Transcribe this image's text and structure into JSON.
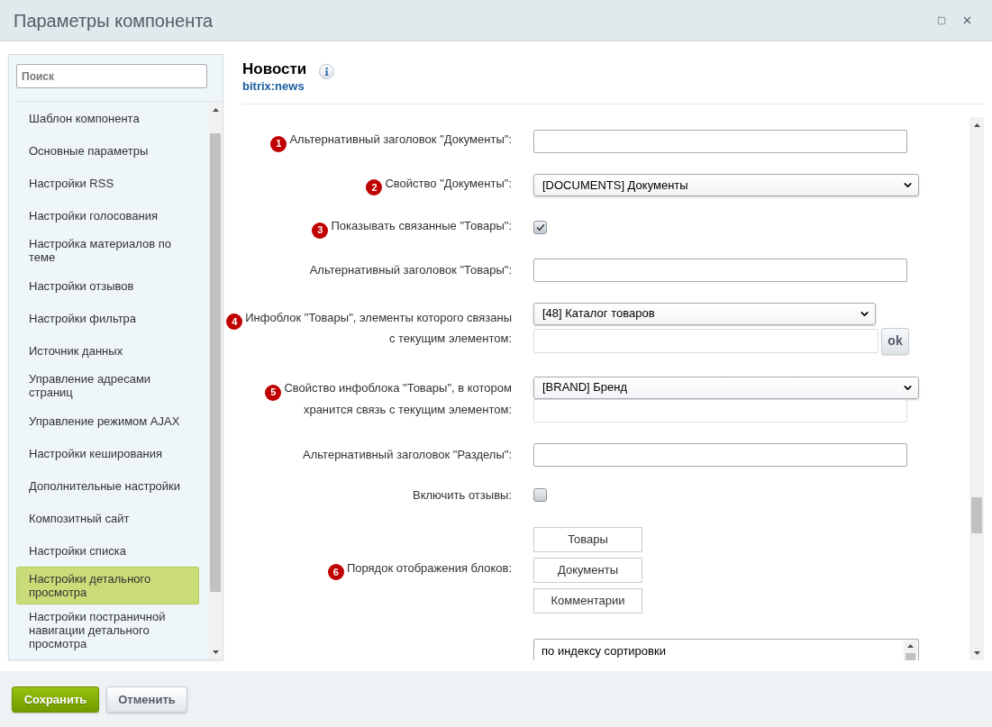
{
  "window": {
    "title": "Параметры компонента"
  },
  "sidebar": {
    "search": {
      "placeholder": "Поиск"
    },
    "items": [
      {
        "label": "Шаблон компонента",
        "selected": false
      },
      {
        "label": "Основные параметры",
        "selected": false
      },
      {
        "label": "Настройки RSS",
        "selected": false
      },
      {
        "label": "Настройки голосования",
        "selected": false
      },
      {
        "label": "Настройка материалов по теме",
        "selected": false
      },
      {
        "label": "Настройки отзывов",
        "selected": false
      },
      {
        "label": "Настройки фильтра",
        "selected": false
      },
      {
        "label": "Источник данных",
        "selected": false
      },
      {
        "label": "Управление адресами страниц",
        "selected": false
      },
      {
        "label": "Управление режимом AJAX",
        "selected": false
      },
      {
        "label": "Настройки кеширования",
        "selected": false
      },
      {
        "label": "Дополнительные настройки",
        "selected": false
      },
      {
        "label": "Композитный сайт",
        "selected": false
      },
      {
        "label": "Настройки списка",
        "selected": false
      },
      {
        "label": "Настройки детального просмотра",
        "selected": true
      },
      {
        "label": "Настройки постраничной навигации детального просмотра",
        "selected": false
      }
    ]
  },
  "component": {
    "title": "Новости",
    "code": "bitrix:news"
  },
  "form": {
    "rows": [
      {
        "kind": "text",
        "marker": "1",
        "label": "Альтернативный заголовок \"Документы\":"
      },
      {
        "kind": "select",
        "marker": "2",
        "label": "Свойство \"Документы\":",
        "value": "[DOCUMENTS] Документы"
      },
      {
        "kind": "checkbox",
        "marker": "3",
        "label": "Показывать связанные \"Товары\":",
        "checked": true
      },
      {
        "kind": "text",
        "label": "Альтернативный заголовок \"Товары\":"
      },
      {
        "kind": "select_filter",
        "marker": "4",
        "label": "Инфоблок \"Товары\", элементы которого связаны с текущим элементом:",
        "value": "[48] Каталог товаров",
        "button": "ok"
      },
      {
        "kind": "select_input",
        "marker": "5",
        "label": "Свойство инфоблока \"Товары\", в котором хранится связь с текущим элементом:",
        "value": "[BRAND] Бренд"
      },
      {
        "kind": "text",
        "label": "Альтернативный заголовок \"Разделы\":"
      },
      {
        "kind": "checkbox",
        "label": "Включить отзывы:",
        "checked": false
      },
      {
        "kind": "order",
        "marker": "6",
        "label": "Порядок отображения блоков:",
        "items": [
          "Товары",
          "Документы",
          "Комментарии"
        ]
      },
      {
        "kind": "listbox",
        "options": [
          "по индексу сортировки"
        ]
      }
    ]
  },
  "footer": {
    "buttons": [
      {
        "label": "Сохранить",
        "kind": "primary"
      },
      {
        "label": "Отменить",
        "kind": "secondary"
      }
    ]
  }
}
